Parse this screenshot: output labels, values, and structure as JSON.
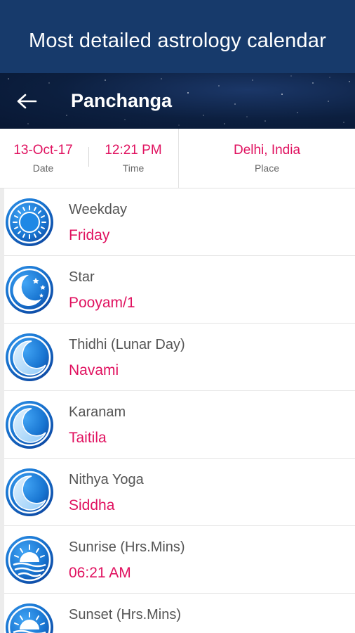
{
  "banner": {
    "text": "Most detailed astrology calendar"
  },
  "appbar": {
    "title": "Panchanga",
    "back_icon": "arrow-left-icon"
  },
  "info": {
    "date": {
      "value": "13-Oct-17",
      "label": "Date"
    },
    "time": {
      "value": "12:21 PM",
      "label": "Time"
    },
    "place": {
      "value": "Delhi, India",
      "label": "Place"
    }
  },
  "colors": {
    "accent": "#e0115f",
    "banner_bg": "#173a6b",
    "appbar_bg": "#0c1f3f",
    "icon_blue": "#1565c0"
  },
  "rows": [
    {
      "label": "Weekday",
      "value": "Friday",
      "icon": "sun-icon"
    },
    {
      "label": "Star",
      "value": "Pooyam/1",
      "icon": "moon-stars-icon"
    },
    {
      "label": "Thidhi (Lunar Day)",
      "value": "Navami",
      "icon": "crescent-moon-icon"
    },
    {
      "label": "Karanam",
      "value": "Taitila",
      "icon": "crescent-moon-icon"
    },
    {
      "label": "Nithya Yoga",
      "value": "Siddha",
      "icon": "crescent-moon-icon"
    },
    {
      "label": "Sunrise (Hrs.Mins)",
      "value": "06:21 AM",
      "icon": "sunrise-icon"
    },
    {
      "label": "Sunset (Hrs.Mins)",
      "value": "",
      "icon": "sunset-icon"
    }
  ]
}
